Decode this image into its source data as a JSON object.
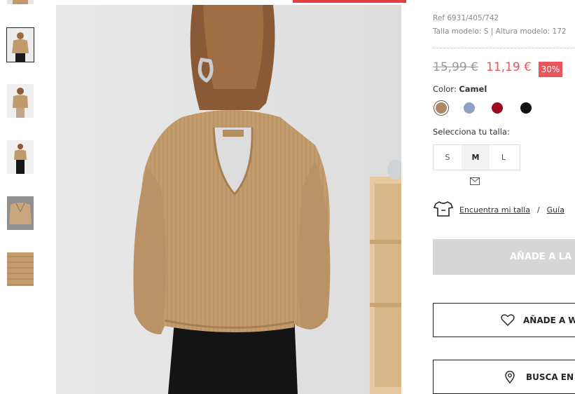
{
  "product": {
    "ref": "Ref 6931/405/742",
    "model_info": "Talla modelo: S | Altura modelo: 172",
    "price_old": "15,99 €",
    "price_new": "11,19 €",
    "discount": "30%",
    "color_prefix": "Color: ",
    "color_name": "Camel",
    "colors": [
      {
        "name": "camel",
        "hex": "#b08862",
        "selected": true
      },
      {
        "name": "blue",
        "hex": "#8ea1c4",
        "selected": false
      },
      {
        "name": "red",
        "hex": "#9c0b1e",
        "selected": false
      },
      {
        "name": "black",
        "hex": "#111111",
        "selected": false
      }
    ],
    "size_label": "Selecciona tu talla:",
    "sizes": [
      "S",
      "M",
      "L"
    ],
    "selected_size": "M"
  },
  "fit": {
    "find_size": "Encuentra mi talla",
    "separator": "/",
    "guide": "Guía"
  },
  "actions": {
    "add_to_cart": "AÑADE A LA C",
    "wishlist": "AÑADE A WI",
    "find_store": "BUSCA EN T"
  },
  "theme": {
    "accent_red": "#e8555a",
    "sweater": "#c19a6b",
    "background": "#e6e6e6"
  }
}
